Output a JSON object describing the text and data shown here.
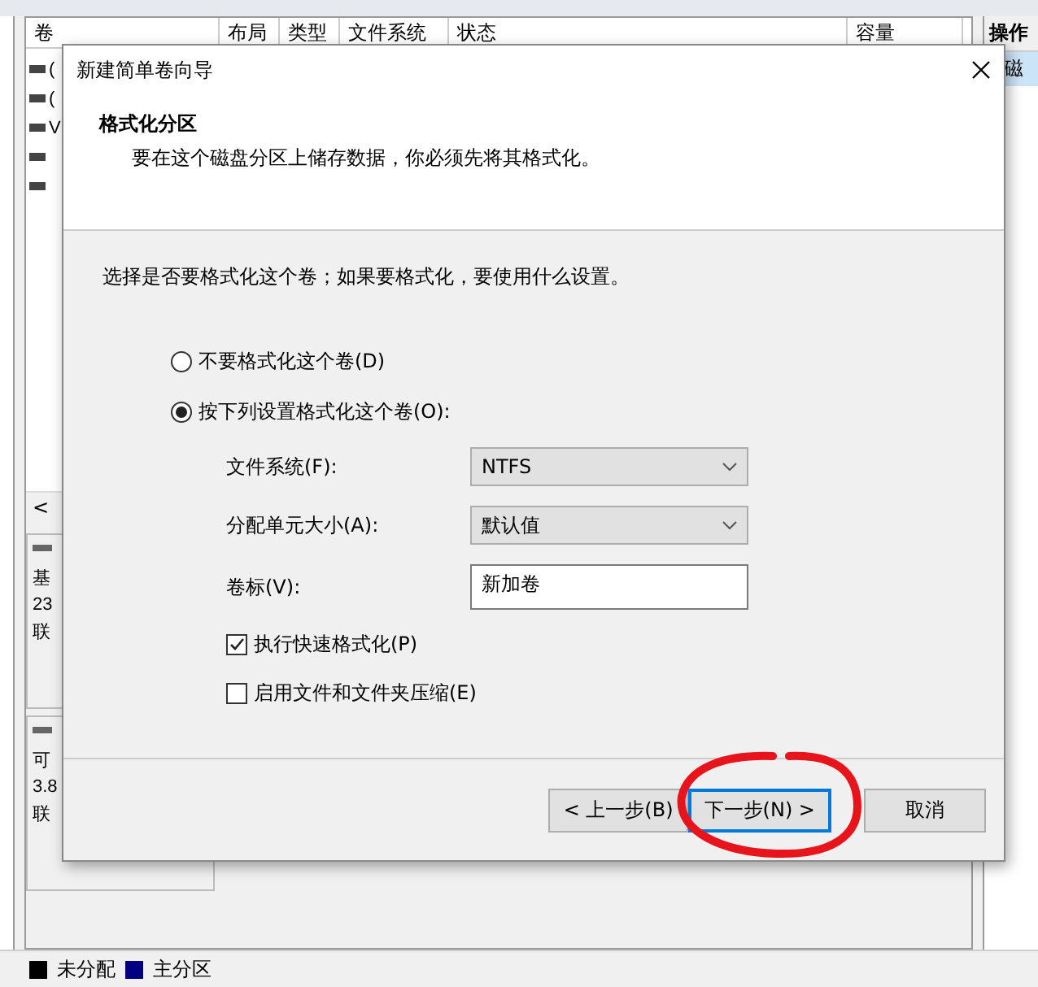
{
  "background": {
    "table": {
      "columns": [
        "卷",
        "布局",
        "类型",
        "文件系统",
        "状态",
        "容量"
      ],
      "rows": [
        {
          "kind": "drive",
          "text": "("
        },
        {
          "kind": "drive",
          "text": "("
        },
        {
          "kind": "drive",
          "text": "V"
        },
        {
          "kind": "drive"
        },
        {
          "kind": "drive"
        }
      ]
    },
    "actions": {
      "title": "操作",
      "items": [
        {
          "label": "磁",
          "selected": true
        }
      ]
    },
    "scroll_arrow": "<",
    "disks": [
      {
        "lines": [
          "基",
          "23",
          "联"
        ]
      },
      {
        "lines": [
          "可",
          "3.8",
          "联"
        ]
      }
    ],
    "legend": [
      {
        "label": "未分配",
        "color": "#000000"
      },
      {
        "label": "主分区",
        "color": "#000080"
      }
    ]
  },
  "dialog": {
    "title": "新建简单卷向导",
    "heading": "格式化分区",
    "subtitle": "要在这个磁盘分区上储存数据，你必须先将其格式化。",
    "instruction": "选择是否要格式化这个卷；如果要格式化，要使用什么设置。",
    "options": [
      {
        "label": "不要格式化这个卷(D)",
        "selected": false
      },
      {
        "label": "按下列设置格式化这个卷(O):",
        "selected": true
      }
    ],
    "fields": [
      {
        "kind": "dropdown",
        "label": "文件系统(F):",
        "value": "NTFS"
      },
      {
        "kind": "dropdown",
        "label": "分配单元大小(A):",
        "value": "默认值"
      },
      {
        "kind": "text",
        "label": "卷标(V):",
        "value": "新加卷"
      }
    ],
    "checks": [
      {
        "label": "执行快速格式化(P)",
        "checked": true
      },
      {
        "label": "启用文件和文件夹压缩(E)",
        "checked": false
      }
    ],
    "buttons": [
      {
        "label": "< 上一步(B)",
        "focused": false,
        "circled": false
      },
      {
        "label": "下一步(N) >",
        "focused": true,
        "circled": true
      },
      {
        "label": "取消",
        "focused": false,
        "circled": false
      }
    ]
  }
}
